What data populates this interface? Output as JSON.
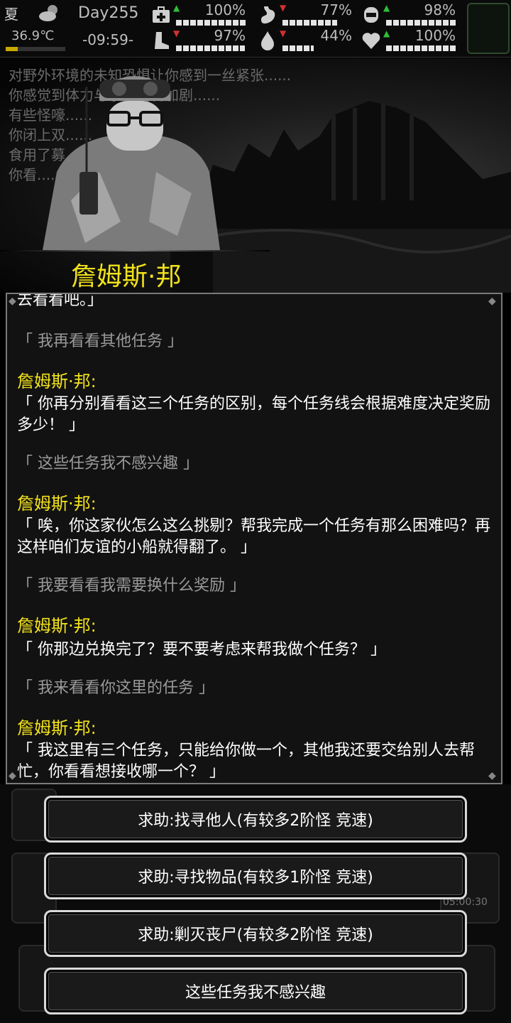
{
  "status": {
    "season": "夏",
    "temperature": "36.9℃",
    "temperature_level": 0.2,
    "day": "Day255",
    "time": "-09:59-",
    "stats": [
      {
        "icon": "health-kit-icon",
        "value": "100%",
        "trend": "up",
        "level": 1.0
      },
      {
        "icon": "stomach-icon",
        "value": "77%",
        "trend": "down",
        "level": 0.77
      },
      {
        "icon": "bandage-icon",
        "value": "98%",
        "trend": "up",
        "level": 0.98
      },
      {
        "icon": "boot-icon",
        "value": "97%",
        "trend": "down",
        "level": 0.97
      },
      {
        "icon": "water-drop-icon",
        "value": "44%",
        "trend": "down",
        "level": 0.44
      },
      {
        "icon": "heart-icon",
        "value": "100%",
        "trend": "up",
        "level": 1.0
      }
    ]
  },
  "scene": {
    "log": [
      "对野外环境的未知恐惧让你感到一丝紧张......",
      "你感觉到体力与水分消耗加剧......",
      "有些怪嚎......",
      "你闭上双......",
      "食用了募......",
      "你看......"
    ],
    "npc_name": "詹姆斯·邦"
  },
  "dialog": {
    "lines": [
      {
        "type": "npc",
        "text": "去看看吧。」"
      },
      {
        "type": "opt",
        "text": "「 我再看看其他任务 」"
      },
      {
        "type": "spk",
        "text": "詹姆斯·邦:"
      },
      {
        "type": "npc",
        "text": "「 你再分别看看这三个任务的区别，每个任务线会根据难度决定奖励多少！ 」"
      },
      {
        "type": "opt",
        "text": "「 这些任务我不感兴趣 」"
      },
      {
        "type": "spk",
        "text": "詹姆斯·邦:"
      },
      {
        "type": "npc",
        "text": "「 唉，你这家伙怎么这么挑剔？帮我完成一个任务有那么困难吗？再这样咱们友谊的小船就得翻了。 」"
      },
      {
        "type": "opt",
        "text": "「 我要看看我需要换什么奖励 」"
      },
      {
        "type": "spk",
        "text": "詹姆斯·邦:"
      },
      {
        "type": "npc",
        "text": "「 你那边兑换完了？要不要考虑来帮我做个任务？ 」"
      },
      {
        "type": "opt",
        "text": "「 我来看看你这里的任务 」"
      },
      {
        "type": "spk",
        "text": "詹姆斯·邦:"
      },
      {
        "type": "npc",
        "text": "「 我这里有三个任务，只能给你做一个，其他我还要交给别人去帮忙，你看看想接收哪一个？ 」"
      }
    ]
  },
  "background_ui": {
    "timer": "05:00:30"
  },
  "choices": [
    "求助:找寻他人(有较多2阶怪 竞速)",
    "求助:寻找物品(有较多1阶怪 竞速)",
    "求助:剿灭丧尸(有较多2阶怪 竞速)",
    "这些任务我不感兴趣"
  ]
}
